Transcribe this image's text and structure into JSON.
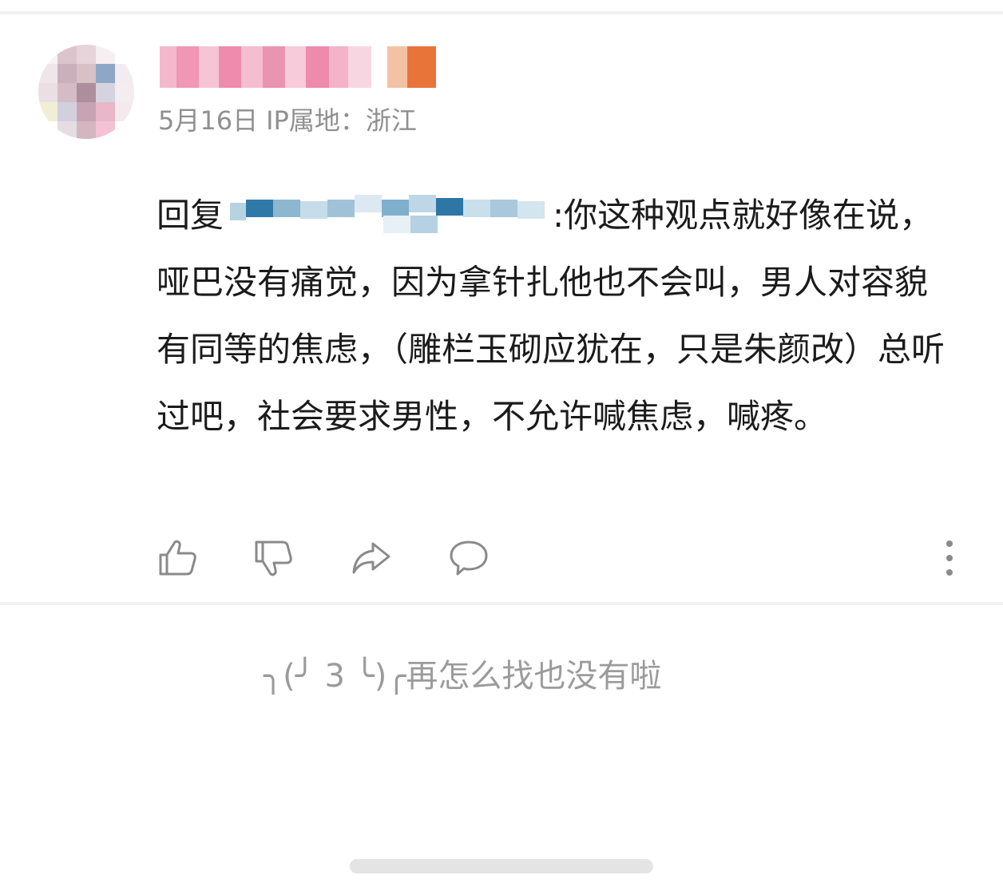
{
  "comment": {
    "date": "5月16日",
    "ip_location": "IP属地：浙江",
    "reply_prefix": "回复",
    "text_after_mention": ":你这种观点就好像在说，哑巴没有痛觉，因为拿针扎他也不会叫，男人对容貌有同等的焦虑，（雕栏玉砌应犹在，只是朱颜改）总听过吧，社会要求男性，不允许喊焦虑，喊疼。"
  },
  "actions": {
    "like": "thumbs-up-icon",
    "dislike": "thumbs-down-icon",
    "share": "share-arrow-icon",
    "reply": "comment-bubble-icon",
    "more": "more-vertical-icon"
  },
  "footer": {
    "end_message": "╮(╯ 3 ╰)╭再怎么找也没有啦"
  },
  "colors": {
    "meta_text": "#8f8f8f",
    "icon_stroke": "#8a8a8a",
    "footer_text": "#9b9b9b"
  }
}
